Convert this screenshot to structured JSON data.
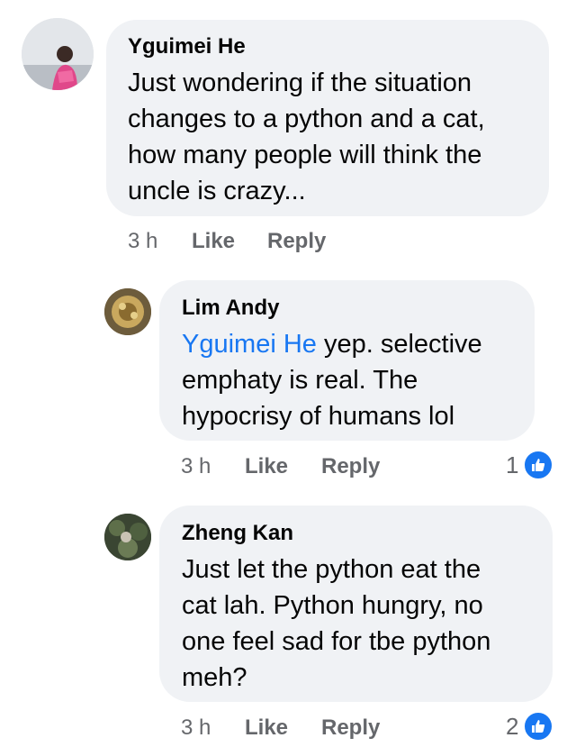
{
  "comments": [
    {
      "author": "Yguimei He",
      "lines": [
        "Just wondering if the situation",
        "changes to a python and a cat,",
        "how many people will think the",
        "uncle is crazy..."
      ],
      "time": "3 h",
      "like_label": "Like",
      "reply_label": "Reply"
    },
    {
      "author": "Lim Andy",
      "mention": "Yguimei He",
      "first_line_rest": " yep. selective",
      "lines": [
        "emphaty is real. The",
        "hypocrisy of humans lol"
      ],
      "time": "3 h",
      "like_label": "Like",
      "reply_label": "Reply",
      "reaction_count": "1",
      "reaction_icon": "like-thumb-icon"
    },
    {
      "author": "Zheng Kan",
      "lines": [
        "Just let the python eat the",
        "cat lah. Python hungry, no",
        "one feel sad for tbe python",
        "meh?"
      ],
      "time": "3 h",
      "like_label": "Like",
      "reply_label": "Reply",
      "reaction_count": "2",
      "reaction_icon": "like-thumb-icon"
    }
  ],
  "colors": {
    "bubble": "#f0f2f5",
    "mention": "#1877f2",
    "meta": "#65676b",
    "like": "#1877f2"
  }
}
